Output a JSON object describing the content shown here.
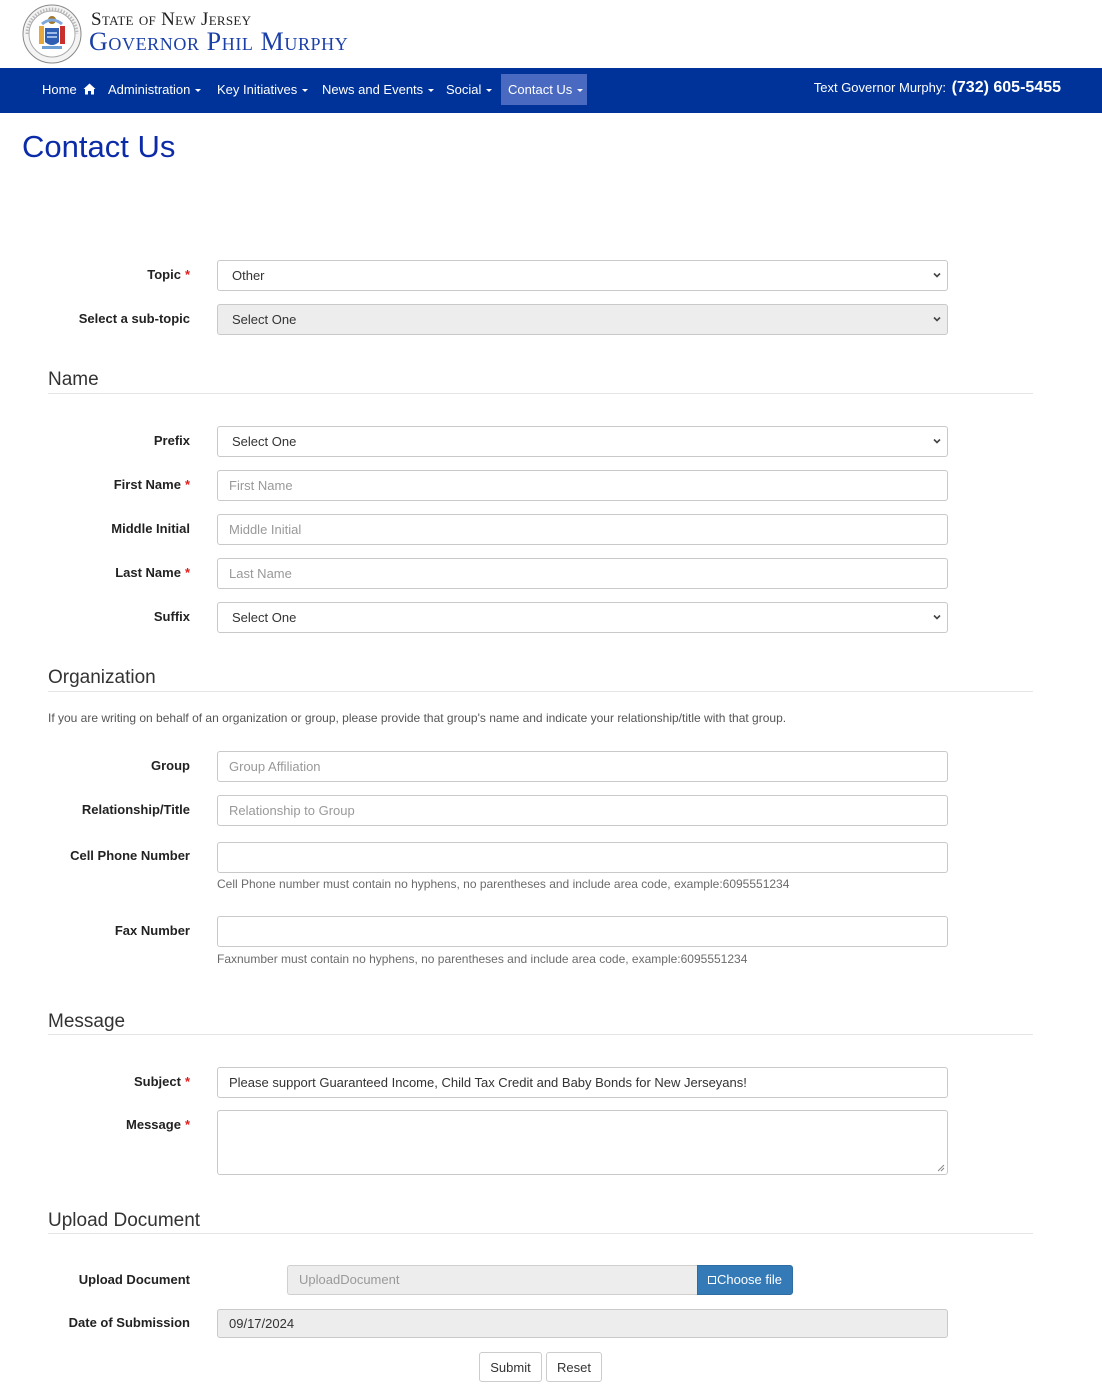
{
  "brand": {
    "state_line": "State of New Jersey",
    "governor_line": "Governor Phil Murphy",
    "seal_icon": "nj-state-seal"
  },
  "nav": {
    "items": [
      {
        "label": "Home",
        "icon": "home-icon",
        "has_caret": false,
        "active": false
      },
      {
        "label": "Administration",
        "has_caret": true,
        "active": false
      },
      {
        "label": "Key Initiatives",
        "has_caret": true,
        "active": false
      },
      {
        "label": "News and Events",
        "has_caret": true,
        "active": false
      },
      {
        "label": "Social",
        "has_caret": true,
        "active": false
      },
      {
        "label": "Contact Us",
        "has_caret": true,
        "active": true
      }
    ],
    "text_governor_label": "Text Governor Murphy:",
    "text_governor_phone": "(732) 605-5455"
  },
  "page": {
    "title": "Contact Us"
  },
  "colors": {
    "nav_bg": "#003399",
    "nav_active": "#4a6ac2",
    "title": "#0c2ba8",
    "required": "#e31b1b",
    "primary_button": "#337ab7"
  },
  "form": {
    "topic": {
      "label": "Topic",
      "required": true,
      "value": "Other"
    },
    "subtopic": {
      "label": "Select a sub-topic",
      "value": "Select One",
      "disabled": true
    },
    "name_section": {
      "title": "Name",
      "prefix": {
        "label": "Prefix",
        "value": "Select One"
      },
      "first_name": {
        "label": "First Name",
        "required": true,
        "placeholder": "First Name",
        "value": ""
      },
      "middle_initial": {
        "label": "Middle Initial",
        "placeholder": "Middle Initial",
        "value": ""
      },
      "last_name": {
        "label": "Last Name",
        "required": true,
        "placeholder": "Last Name",
        "value": ""
      },
      "suffix": {
        "label": "Suffix",
        "value": "Select One"
      }
    },
    "organization_section": {
      "title": "Organization",
      "intro": "If you are writing on behalf of an organization or group, please provide that group's name and indicate your relationship/title with that group.",
      "group": {
        "label": "Group",
        "placeholder": "Group Affiliation",
        "value": ""
      },
      "relationship": {
        "label": "Relationship/Title",
        "placeholder": "Relationship to Group",
        "value": ""
      },
      "cell_phone": {
        "label": "Cell Phone Number",
        "value": "",
        "help": "Cell Phone number must contain no hyphens, no parentheses and include area code, example:6095551234"
      },
      "fax": {
        "label": "Fax Number",
        "value": "",
        "help": "Faxnumber must contain no hyphens, no parentheses and include area code, example:6095551234"
      }
    },
    "message_section": {
      "title": "Message",
      "subject": {
        "label": "Subject",
        "required": true,
        "value": "Please support Guaranteed Income, Child Tax Credit and Baby Bonds for New Jerseyans!"
      },
      "message": {
        "label": "Message",
        "required": true,
        "value": ""
      }
    },
    "upload_section": {
      "title": "Upload Document",
      "upload": {
        "label": "Upload Document",
        "placeholder": "UploadDocument",
        "button_label": "Choose file"
      },
      "date": {
        "label": "Date of Submission",
        "value": "09/17/2024"
      }
    },
    "submit_label": "Submit",
    "reset_label": "Reset",
    "required_marker": "*"
  }
}
